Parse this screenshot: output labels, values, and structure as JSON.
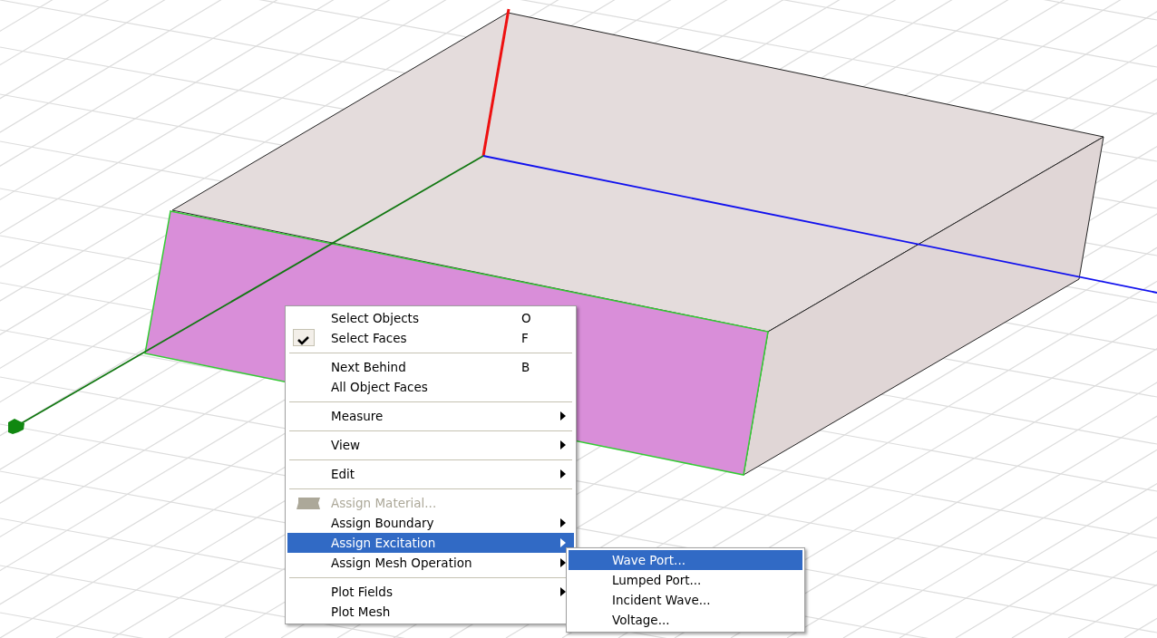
{
  "context_menu": {
    "items": [
      {
        "kind": "item",
        "label": "Select Objects",
        "shortcut": "O",
        "checked": false,
        "disabled": false,
        "selected": false,
        "submenu": false
      },
      {
        "kind": "item",
        "label": "Select Faces",
        "shortcut": "F",
        "checked": true,
        "disabled": false,
        "selected": false,
        "submenu": false
      },
      {
        "kind": "separator"
      },
      {
        "kind": "item",
        "label": "Next Behind",
        "shortcut": "B",
        "checked": false,
        "disabled": false,
        "selected": false,
        "submenu": false
      },
      {
        "kind": "item",
        "label": "All Object Faces",
        "checked": false,
        "disabled": false,
        "selected": false,
        "submenu": false
      },
      {
        "kind": "separator"
      },
      {
        "kind": "item",
        "label": "Measure",
        "checked": false,
        "disabled": false,
        "selected": false,
        "submenu": true
      },
      {
        "kind": "separator"
      },
      {
        "kind": "item",
        "label": "View",
        "checked": false,
        "disabled": false,
        "selected": false,
        "submenu": true
      },
      {
        "kind": "separator"
      },
      {
        "kind": "item",
        "label": "Edit",
        "checked": false,
        "disabled": false,
        "selected": false,
        "submenu": true
      },
      {
        "kind": "separator"
      },
      {
        "kind": "icon_item",
        "label": "Assign Material...",
        "checked": false,
        "disabled": true,
        "selected": false,
        "submenu": false
      },
      {
        "kind": "item",
        "label": "Assign Boundary",
        "checked": false,
        "disabled": false,
        "selected": false,
        "submenu": true
      },
      {
        "kind": "item",
        "label": "Assign Excitation",
        "checked": false,
        "disabled": false,
        "selected": true,
        "submenu": true
      },
      {
        "kind": "item",
        "label": "Assign Mesh Operation",
        "checked": false,
        "disabled": false,
        "selected": false,
        "submenu": true
      },
      {
        "kind": "separator"
      },
      {
        "kind": "item",
        "label": "Plot Fields",
        "checked": false,
        "disabled": false,
        "selected": false,
        "submenu": true
      },
      {
        "kind": "item",
        "label": "Plot Mesh",
        "checked": false,
        "disabled": false,
        "selected": false,
        "submenu": false
      }
    ]
  },
  "submenu": {
    "items": [
      {
        "label": "Wave Port...",
        "selected": true
      },
      {
        "label": "Lumped Port...",
        "selected": false
      },
      {
        "label": "Incident Wave...",
        "selected": false
      },
      {
        "label": "Voltage...",
        "selected": false
      }
    ]
  },
  "model": {
    "selected_face": true
  }
}
